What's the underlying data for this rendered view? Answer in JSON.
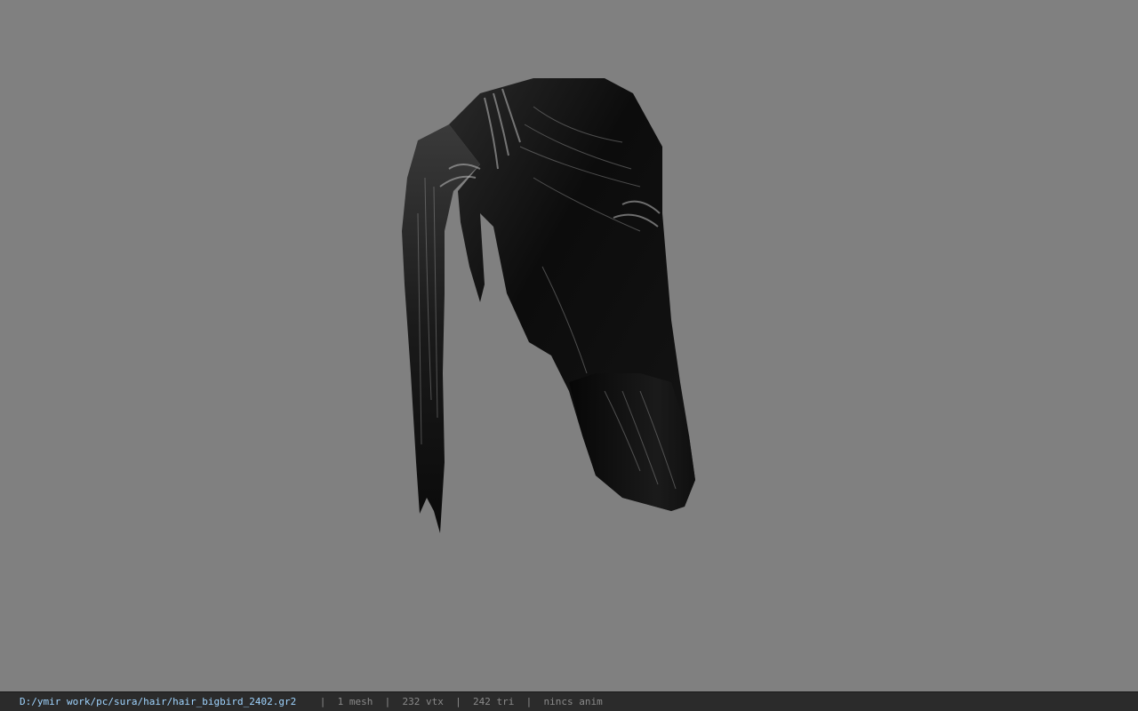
{
  "viewport": {
    "background_color": "#808080",
    "model_description_icon": "hair-mesh-icon"
  },
  "status_bar": {
    "file_path": "D:/ymir work/pc/sura/hair/hair_bigbird_2402.gr2",
    "separator": "|",
    "mesh_count": "1 mesh",
    "vertex_count": "232 vtx",
    "triangle_count": "242 tri",
    "anim_info": "nincs anim",
    "path_color": "#9fd4ff",
    "text_color": "#8a8a8a",
    "bar_color": "#2b2b2b"
  }
}
